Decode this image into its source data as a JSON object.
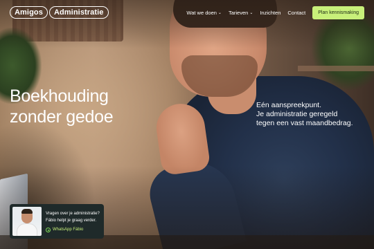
{
  "header": {
    "logo": {
      "part1": "Amigos",
      "part2": "Administratie"
    },
    "nav": [
      {
        "label": "Wat we doen",
        "has_dropdown": true
      },
      {
        "label": "Tarieven",
        "has_dropdown": true
      },
      {
        "label": "Inzichten",
        "has_dropdown": false
      },
      {
        "label": "Contact",
        "has_dropdown": false
      }
    ],
    "cta_label": "Plan kennismaking"
  },
  "hero": {
    "title_line1": "Boekhouding",
    "title_line2": "zonder gedoe",
    "tagline_line1": "Eén aanspreekpunt.",
    "tagline_line2": "Je administratie geregeld",
    "tagline_line3": "tegen een vast maandbedrag."
  },
  "widget": {
    "line1": "Vragen over je administratie?",
    "line2": "Fábio helpt je graag verder.",
    "whatsapp_label": "WhatsApp Fábio"
  },
  "colors": {
    "accent": "#c8f07a",
    "widget_bg": "#1f2a2a",
    "text": "#ffffff"
  },
  "icons": {
    "chevron": "chevron-down-icon",
    "whatsapp": "whatsapp-icon"
  }
}
